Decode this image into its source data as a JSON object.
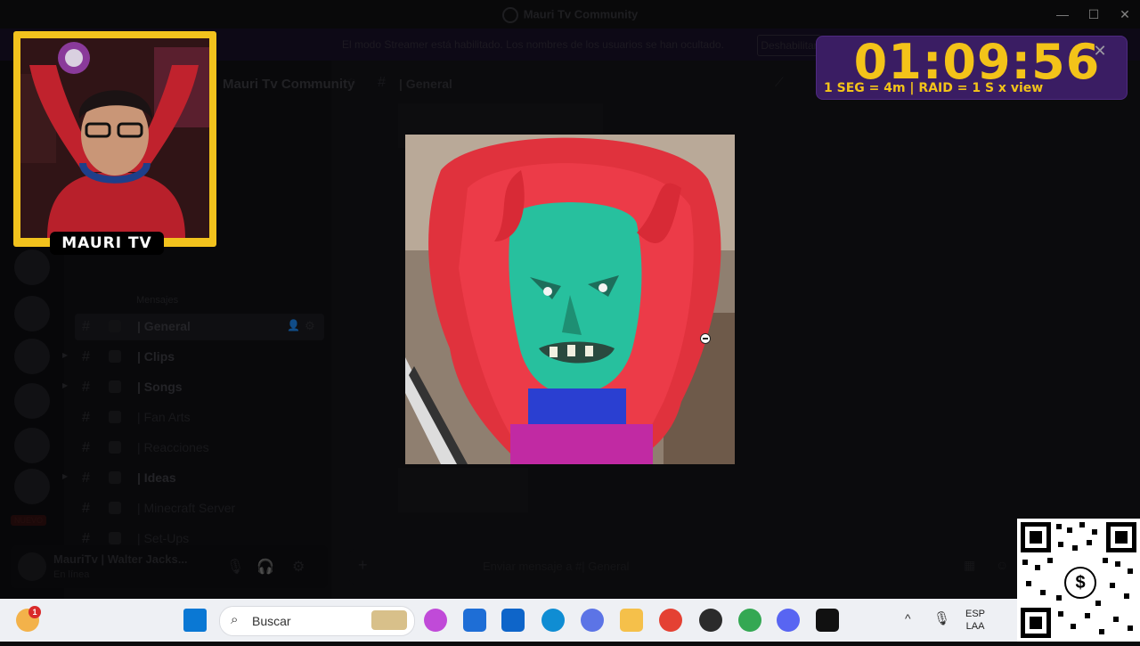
{
  "window": {
    "title": "Mauri Tv Community",
    "controls": {
      "minimize": "—",
      "maximize": "☐",
      "close": "✕"
    }
  },
  "notice": {
    "text": "El modo Streamer está habilitado. Los nombres de los usuarios se han ocultado.",
    "button": "Deshabilitar"
  },
  "rail": {
    "new_badge": "NUEVO"
  },
  "sidebar": {
    "server_name": "Mauri Tv Community",
    "category_text": "Mensajes",
    "channels": [
      {
        "label": "| General",
        "selected": true
      },
      {
        "label": "| Clips"
      },
      {
        "label": "| Songs"
      },
      {
        "label": "| Fan Arts"
      },
      {
        "label": "| Reacciones"
      },
      {
        "label": "| Ideas"
      },
      {
        "label": "| Minecraft Server"
      },
      {
        "label": "| Set-Ups"
      }
    ]
  },
  "user_panel": {
    "name": "MauriTv | Walter Jacks...",
    "status": "En línea"
  },
  "chat": {
    "channel_title": "| General",
    "input_placeholder": "Enviar mensaje a #| General"
  },
  "stream_overlay": {
    "webcam_badge": "MAURI TV",
    "timer": "01:09:56",
    "timer_rules": "1 SEG = 4m | RAID = 1 S x view",
    "close": "✕"
  },
  "taskbar": {
    "search_placeholder": "Buscar",
    "weather_badge": "1",
    "lang_top": "ESP",
    "lang_bottom": "LAA"
  },
  "qr": {
    "symbol": "$"
  }
}
